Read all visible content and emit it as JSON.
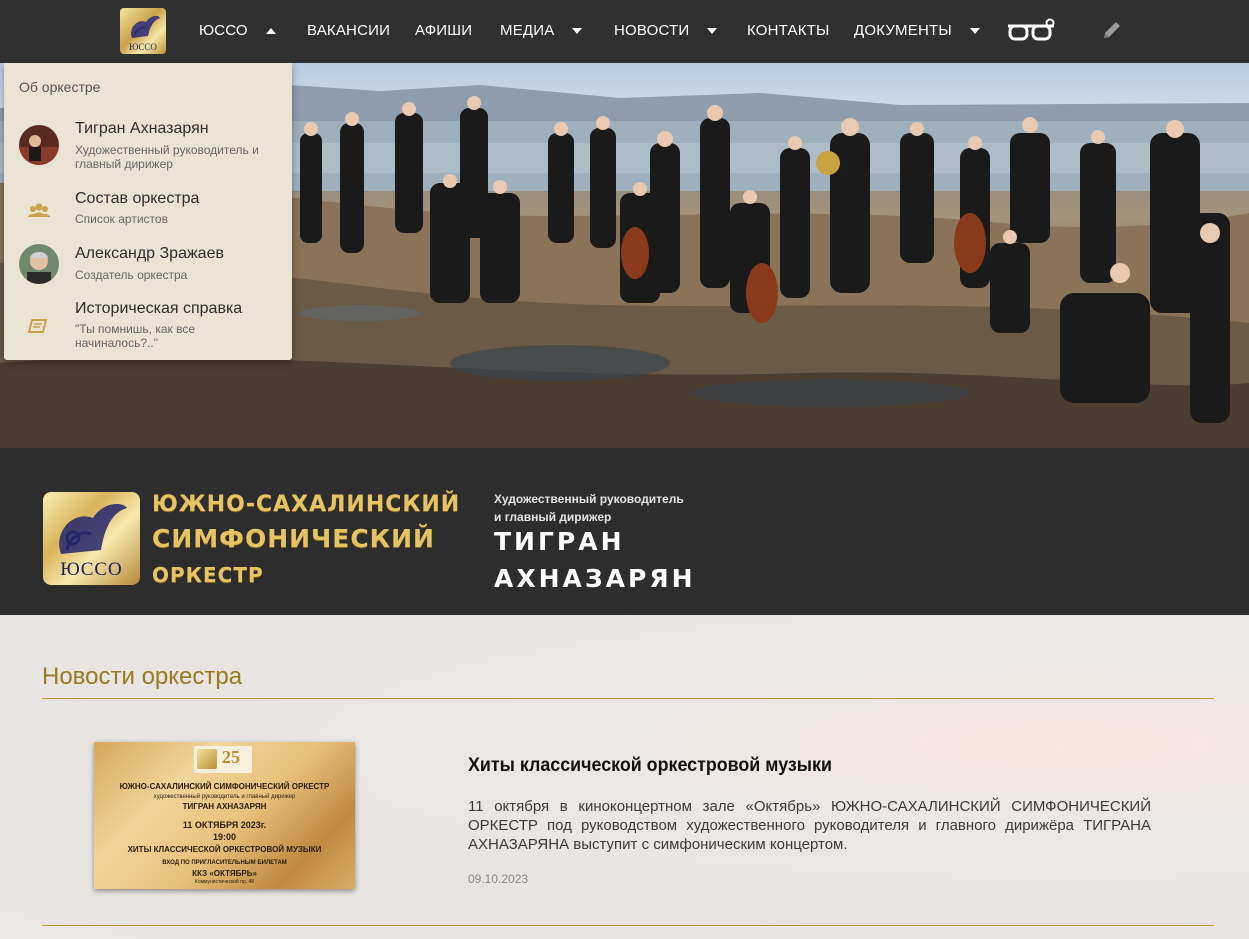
{
  "nav": {
    "logo_text": "ЮССО",
    "items": [
      {
        "label": "ЮССО",
        "caret": "up"
      },
      {
        "label": "ВАКАНСИИ"
      },
      {
        "label": "АФИШИ"
      },
      {
        "label": "МЕДИА",
        "caret": "down"
      },
      {
        "label": "НОВОСТИ",
        "caret": "down"
      },
      {
        "label": "КОНТАКТЫ"
      },
      {
        "label": "ДОКУМЕНТЫ",
        "caret": "down"
      }
    ],
    "icons": [
      "glasses-icon",
      "pencil-icon"
    ]
  },
  "dropdown": {
    "header": "Об оркестре",
    "items": [
      {
        "title": "Тигран Ахназарян",
        "subtitle": "Художественный руководитель и главный дирижер",
        "icon": "avatar-conductor"
      },
      {
        "title": "Состав оркестра",
        "subtitle": "Список артистов",
        "icon": "people-icon"
      },
      {
        "title": "Александр Зражаев",
        "subtitle": "Создатель оркестра",
        "icon": "avatar-founder"
      },
      {
        "title": "Историческая справка",
        "subtitle": "\"Ты помнишь, как все начиналось?..\"",
        "icon": "scroll-icon"
      }
    ]
  },
  "brand": {
    "logo_text": "ЮССО",
    "name_line1": "ЮЖНО-САХАЛИНСКИЙ",
    "name_line2": "СИМФОНИЧЕСКИЙ",
    "name_line3": "ОРКЕСТР",
    "conductor_role_line1": "Художественный руководитель",
    "conductor_role_line2": "и главный дирижер",
    "conductor_name_line1": "ТИГРАН",
    "conductor_name_line2": "АХНАЗАРЯН"
  },
  "news": {
    "heading": "Новости оркестра",
    "items": [
      {
        "poster": {
          "badge": "25",
          "line1": "ЮЖНО-САХАЛИНСКИЙ СИМФОНИЧЕСКИЙ ОРКЕСТР",
          "line2": "художественный руководитель и главный дирижер",
          "line3": "ТИГРАН АХНАЗАРЯН",
          "line4": "11 ОКТЯБРЯ 2023г.",
          "line5": "19:00",
          "line6": "ХИТЫ КЛАССИЧЕСКОЙ ОРКЕСТРОВОЙ МУЗЫКИ",
          "line7": "ВХОД ПО ПРИГЛАСИТЕЛЬНЫМ БИЛЕТАМ",
          "line8": "ККЗ «ОКТЯБРЬ»",
          "line9": "Коммунистический пр. 48"
        },
        "title": "Хиты классической оркестровой музыки",
        "body": "11 октября в киноконцертном зале «Октябрь» ЮЖНО-САХАЛИНСКИЙ СИМФОНИЧЕСКИЙ ОРКЕСТР под руководством художественного руководителя и главного дирижёра ТИГРАНА АХНАЗАРЯНА выступит с симфоническим концертом.",
        "date": "09.10.2023"
      }
    ]
  },
  "colors": {
    "nav_bg": "#303030",
    "brand_bg": "#2d2d2d",
    "gold": "#e7c463",
    "news_heading": "#9a7a1e",
    "rule": "#c09a3a"
  }
}
